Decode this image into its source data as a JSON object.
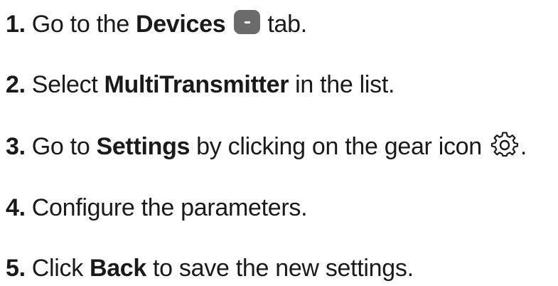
{
  "steps": [
    {
      "number": "1.",
      "text_before": "Go to the",
      "bold": "Devices",
      "icon": "devices-tab-icon",
      "text_after": "tab."
    },
    {
      "number": "2.",
      "text_before": "Select",
      "bold": "MultiTransmitter",
      "text_after": "in the list."
    },
    {
      "number": "3.",
      "text_before": "Go to",
      "bold": "Settings",
      "text_after": "by clicking on the gear icon",
      "icon": "gear-icon",
      "trailing": "."
    },
    {
      "number": "4.",
      "text": "Configure the parameters."
    },
    {
      "number": "5.",
      "text_before": "Click",
      "bold": "Back",
      "text_after": "to save the new settings."
    }
  ],
  "colors": {
    "text": "#1a1a1a",
    "icon_fill": "#6b6b6b"
  }
}
